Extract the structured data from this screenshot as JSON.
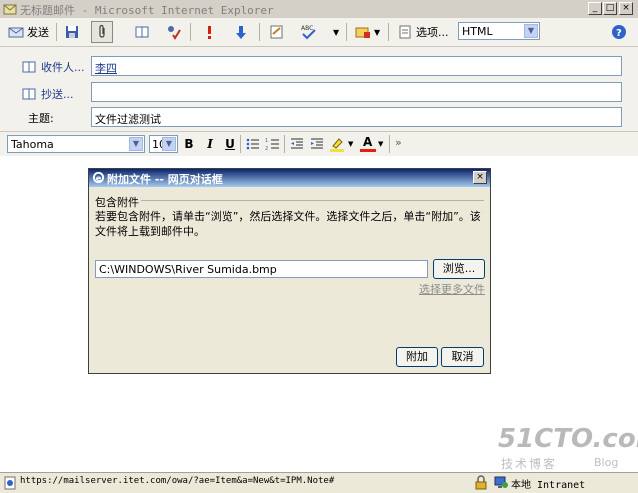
{
  "window": {
    "title": "无标题邮件 - Microsoft Internet Explorer",
    "minimize": "_",
    "maximize": "□",
    "close": "×"
  },
  "toolbar": {
    "send_label": "发送",
    "options_label": "选项...",
    "format_value": "HTML"
  },
  "header": {
    "to_label": "收件人...",
    "to_value": "李四",
    "cc_label": "抄送...",
    "cc_value": "",
    "subject_label": "主题:",
    "subject_value": "文件过滤测试"
  },
  "format_bar": {
    "font_value": "Tahoma",
    "size_value": "10",
    "bold": "B",
    "italic": "I",
    "underline": "U",
    "font_color_glyph": "A",
    "more_glyph": "»"
  },
  "dialog": {
    "title": "附加文件  --  网页对话框",
    "close": "×",
    "group_label": "包含附件",
    "instructions": "若要包含附件，请单击“浏览”，然后选择文件。选择文件之后，单击“附加”。该文件将上载到邮件中。",
    "file_path": "C:\\WINDOWS\\River Sumida.bmp",
    "browse_label": "浏览...",
    "more_files_label": "选择更多文件",
    "attach_label": "附加",
    "cancel_label": "取消"
  },
  "statusbar": {
    "url": "https://mailserver.itet.com/owa/?ae=Item&a=New&t=IPM.Note#",
    "zone": "本地 Intranet"
  },
  "watermark": {
    "site": "51CTO.com",
    "tagline": "技术博客",
    "blog": "Blog"
  }
}
